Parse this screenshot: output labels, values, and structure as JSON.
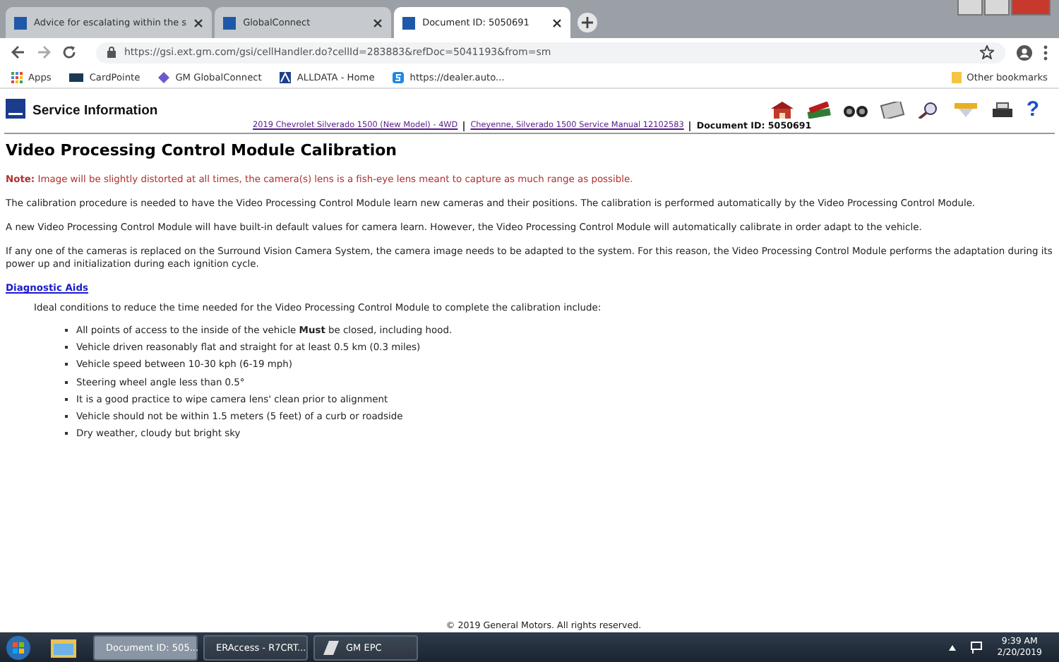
{
  "browser": {
    "tabs": [
      {
        "title": "Advice for escalating within the s",
        "selected": false
      },
      {
        "title": "GlobalConnect",
        "selected": false
      },
      {
        "title": "Document ID: 5050691",
        "selected": true
      }
    ],
    "url": "https://gsi.ext.gm.com/gsi/cellHandler.do?cellId=283883&refDoc=5041193&from=sm",
    "bookmarks": [
      {
        "label": "Apps",
        "kind": "apps"
      },
      {
        "label": "CardPointe",
        "kind": "card"
      },
      {
        "label": "GM GlobalConnect",
        "kind": "diamond"
      },
      {
        "label": "ALLDATA - Home",
        "kind": "alldata"
      },
      {
        "label": "https://dealer.auto...",
        "kind": "s"
      }
    ],
    "other_bookmarks": "Other bookmarks"
  },
  "header": {
    "title": "Service Information",
    "help": "?",
    "breadcrumbs": [
      "2019 Chevrolet Silverado 1500 (New Model) - 4WD",
      "Cheyenne, Silverado 1500 Service Manual 12102583"
    ],
    "document_id": "Document ID: 5050691"
  },
  "document": {
    "title": "Video Processing Control Module Calibration",
    "note": {
      "label": "Note:",
      "text": "Image will be slightly distorted at all times, the camera(s) lens is a fish-eye lens meant to capture as much range as possible."
    },
    "paragraphs": [
      "The calibration procedure is needed to have the Video Processing Control Module learn new cameras and their positions. The calibration is performed automatically by the Video Processing Control Module.",
      "A new Video Processing Control Module will have built-in default values for camera learn. However, the Video Processing Control Module will automatically calibrate in order adapt to the vehicle.",
      "If any one of the cameras is replaced on the Surround Vision Camera System, the camera image needs to be adapted to the system. For this reason, the Video Processing Control Module performs the adaptation during its power up and initialization during each ignition cycle."
    ],
    "section_link": "Diagnostic Aids",
    "intro": "Ideal conditions to reduce the time needed for the Video Processing Control Module to complete the calibration include:",
    "conditions": [
      "All points of access to the inside of the vehicle **Must** be closed, including hood.",
      "Vehicle driven reasonably flat and straight for at least 0.5 km (0.3 miles)",
      "Vehicle speed between 10-30 kph (6-19 mph)",
      "Steering wheel angle less than 0.5°",
      "It is a good practice to wipe camera lens' clean prior to alignment",
      "Vehicle should not be within 1.5 meters (5 feet) of a curb or roadside",
      "Dry weather, cloudy but bright sky"
    ]
  },
  "footer": "© 2019 General Motors.  All rights reserved.",
  "taskbar": {
    "items": [
      {
        "label": "Document ID: 505...",
        "kind": "chrome",
        "selected": true
      },
      {
        "label": "ERAccess - R7CRT...",
        "kind": "link",
        "selected": false
      },
      {
        "label": "GM EPC",
        "kind": "epc",
        "selected": false
      }
    ],
    "time": "9:39 AM",
    "date": "2/20/2019"
  }
}
